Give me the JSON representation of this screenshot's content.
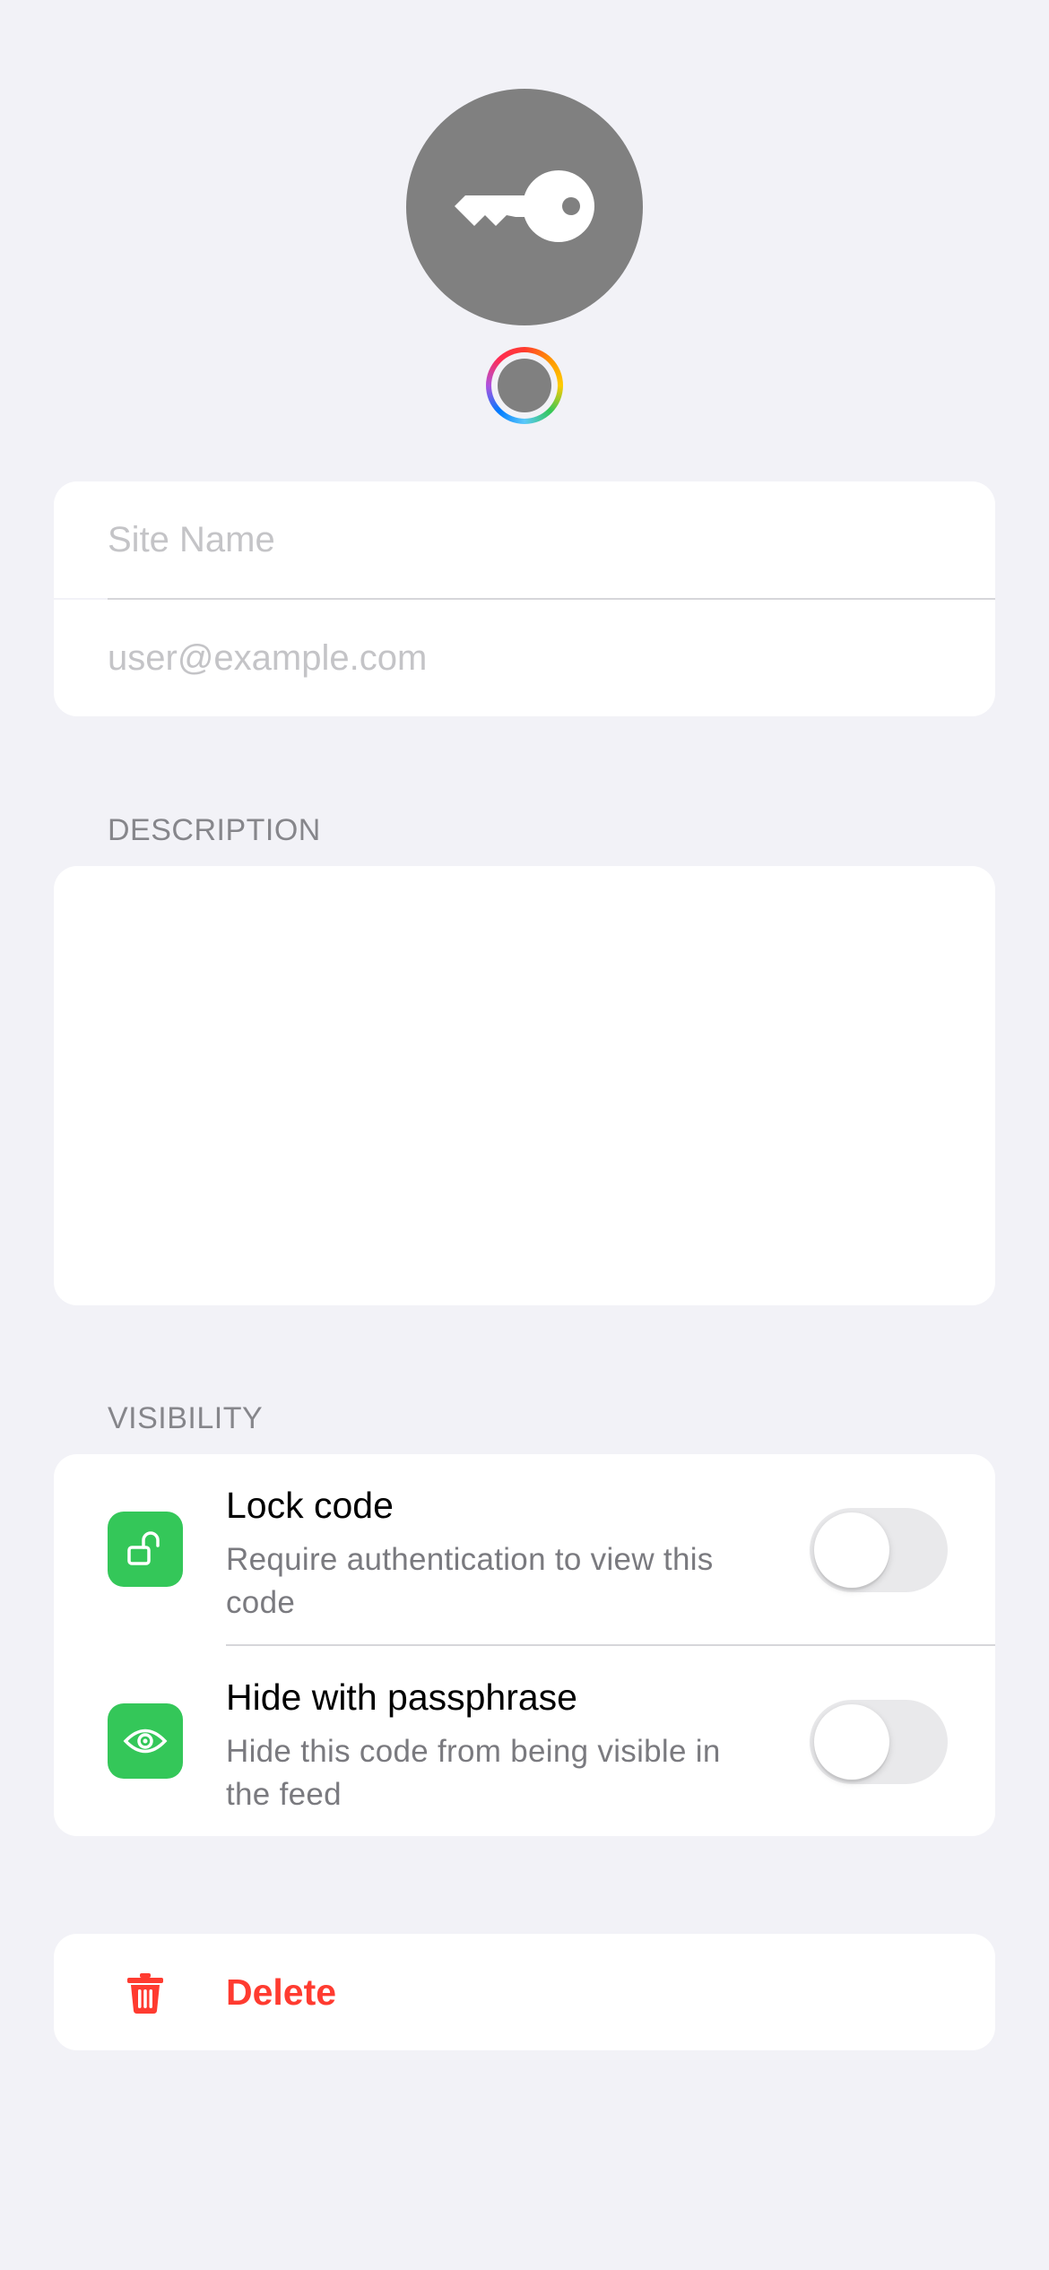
{
  "header": {
    "avatar_icon": "key-icon",
    "color_picker_icon": "color-wheel-icon",
    "avatar_color": "#808080"
  },
  "fields": {
    "site_name": {
      "value": "",
      "placeholder": "Site Name"
    },
    "account": {
      "value": "",
      "placeholder": "user@example.com"
    }
  },
  "description": {
    "header": "DESCRIPTION",
    "value": ""
  },
  "visibility": {
    "header": "VISIBILITY",
    "items": [
      {
        "icon": "unlock-icon",
        "title": "Lock code",
        "subtitle": "Require authentication to view this code",
        "enabled": false
      },
      {
        "icon": "eye-icon",
        "title": "Hide with passphrase",
        "subtitle": "Hide this code from being visible in the feed",
        "enabled": false
      }
    ]
  },
  "delete": {
    "icon": "trash-icon",
    "label": "Delete",
    "color": "#ff3b30"
  },
  "colors": {
    "background": "#f2f2f7",
    "accent_green": "#34c759",
    "destructive": "#ff3b30"
  }
}
